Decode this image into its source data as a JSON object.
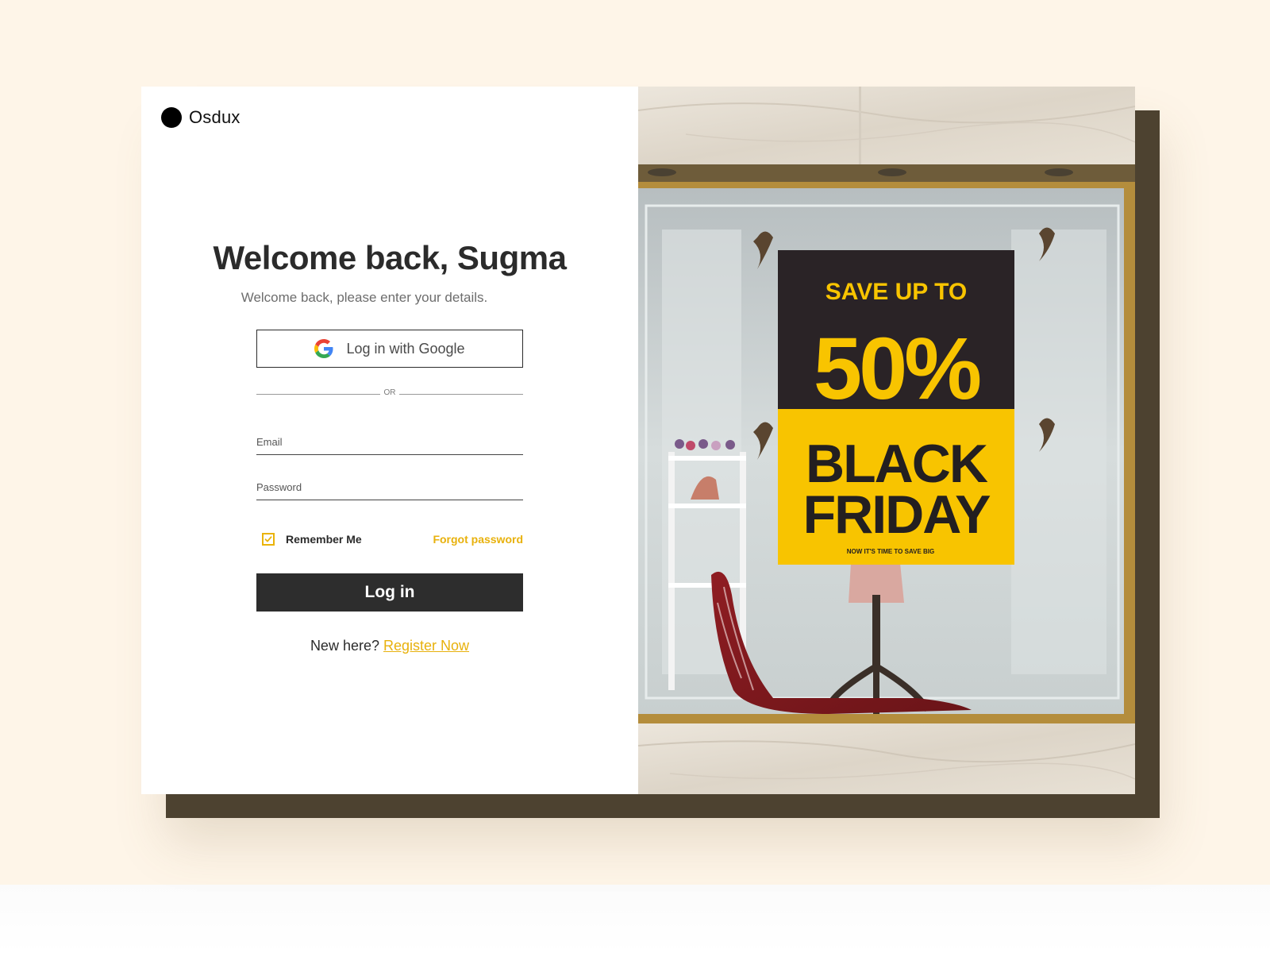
{
  "brand": {
    "name": "Osdux"
  },
  "login": {
    "heading": "Welcome back, Sugma",
    "subheading": "Welcome back, please enter your details.",
    "google_label": "Log in with Google",
    "divider_text": "OR",
    "email_placeholder": "Email",
    "password_placeholder": "Password",
    "remember_label": "Remember Me",
    "remember_checked": true,
    "forgot_label": "Forgot password",
    "submit_label": "Log in",
    "register_prompt": "New here?",
    "register_link": "Register Now"
  },
  "poster": {
    "line1": "SAVE UP TO",
    "line2": "50%",
    "line3": "BLACK",
    "line4": "FRIDAY",
    "tagline": "NOW IT'S TIME TO SAVE BIG"
  },
  "colors": {
    "accent": "#e8b10c",
    "button_dark": "#2d2d2d",
    "backdrop": "#fef5e8",
    "shadow_block": "#4d4230",
    "poster_yellow": "#f8c400",
    "poster_dark": "#2a2326"
  },
  "icons": [
    "google-icon",
    "check-icon"
  ]
}
